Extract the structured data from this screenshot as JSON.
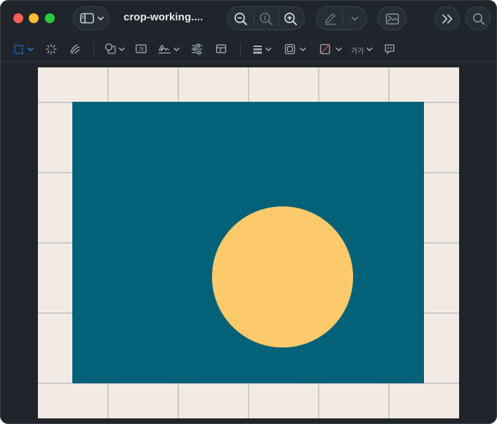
{
  "window": {
    "title": "crop-working...."
  },
  "toolbar": {
    "font_label": "가가"
  },
  "colors": {
    "window_bg": "#1f252b",
    "accent_blue": "#1f84ff",
    "canvas_border": "#f2ebe4",
    "grid_lines": "#b9c0c3",
    "inner_rect": "#036178",
    "circle": "#fdca6b",
    "close": "#fe5f57",
    "minimize": "#febc2e",
    "maximize": "#28c840"
  },
  "icons": {
    "sidebar": "sidebar-icon",
    "zoom_out": "zoom-out-icon",
    "zoom_actual": "zoom-actual-icon",
    "zoom_in": "zoom-in-icon",
    "markup": "pencil-icon",
    "photo": "photo-icon",
    "more": "double-chevron-icon",
    "search": "search-icon"
  }
}
